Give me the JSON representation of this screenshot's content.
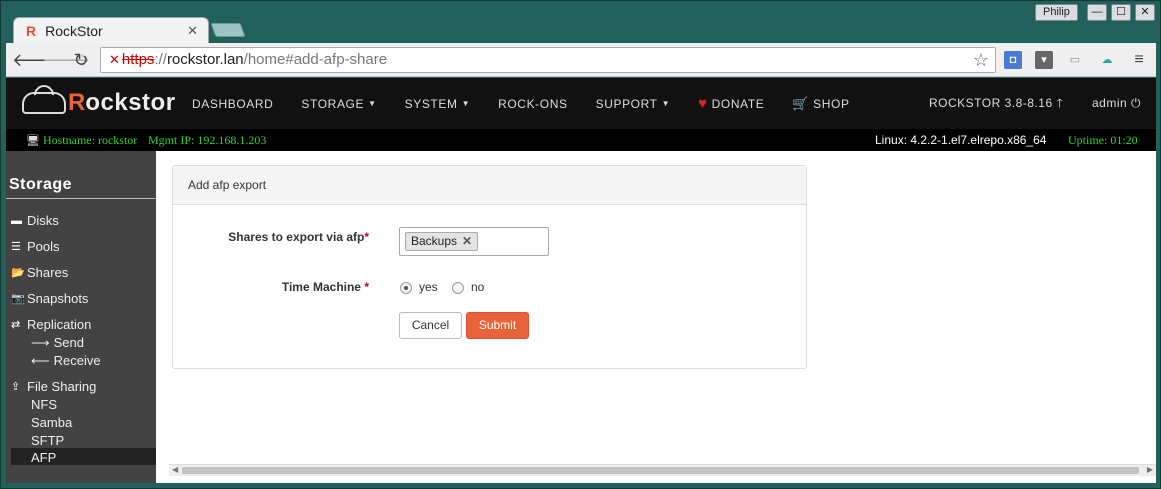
{
  "browser": {
    "tab_title": "RockStor",
    "favicon": "R",
    "profile": "Philip",
    "url_scheme": "https",
    "url_sep": "://",
    "url_host": "rockstor.lan",
    "url_path": "/home#add-afp-share"
  },
  "nav": {
    "brand_r": "R",
    "brand_rest": "ockstor",
    "menu": [
      {
        "label": "DASHBOARD",
        "caret": false
      },
      {
        "label": "STORAGE",
        "caret": true
      },
      {
        "label": "SYSTEM",
        "caret": true
      },
      {
        "label": "ROCK-ONS",
        "caret": false
      },
      {
        "label": "SUPPORT",
        "caret": true
      }
    ],
    "donate": "DONATE",
    "shop": "SHOP",
    "version": "ROCKSTOR 3.8-8.16",
    "user": "admin"
  },
  "status": {
    "hostname": "Hostname: rockstor",
    "mgmt_ip": "Mgmt IP: 192.168.1.203",
    "kernel": "Linux: 4.2.2-1.el7.elrepo.x86_64",
    "uptime": "Uptime: 01:20"
  },
  "sidebar": {
    "title": "Storage",
    "disks": "Disks",
    "pools": "Pools",
    "shares": "Shares",
    "snapshots": "Snapshots",
    "replication": "Replication",
    "send": "Send",
    "receive": "Receive",
    "file_sharing": "File Sharing",
    "nfs": "NFS",
    "samba": "Samba",
    "sftp": "SFTP",
    "afp": "AFP"
  },
  "form": {
    "title": "Add afp export",
    "shares_label": "Shares to export via afp",
    "required_mark": "*",
    "selected_share": "Backups",
    "time_machine_label": "Time Machine",
    "time_machine_value": "yes",
    "opt_yes": "yes",
    "opt_no": "no",
    "cancel": "Cancel",
    "submit": "Submit"
  },
  "colors": {
    "accent": "#e8623a",
    "status_green": "#2fd12f",
    "nav_bg": "#111111",
    "sidebar_bg": "#434343"
  }
}
